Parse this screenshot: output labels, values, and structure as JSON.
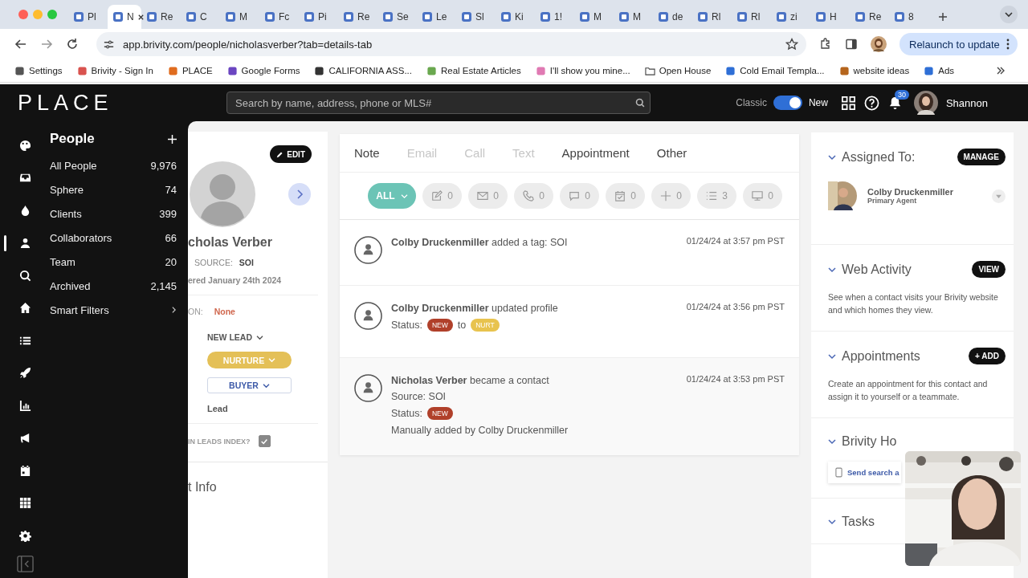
{
  "browser": {
    "tabs": [
      {
        "label": "Pl",
        "selected": false
      },
      {
        "label": "N",
        "selected": true
      },
      {
        "label": "Re",
        "selected": false
      },
      {
        "label": "C",
        "selected": false
      },
      {
        "label": "M",
        "selected": false
      },
      {
        "label": "Fc",
        "selected": false
      },
      {
        "label": "Pi",
        "selected": false
      },
      {
        "label": "Re",
        "selected": false
      },
      {
        "label": "Se",
        "selected": false
      },
      {
        "label": "Le",
        "selected": false
      },
      {
        "label": "Sl",
        "selected": false
      },
      {
        "label": "Ki",
        "selected": false
      },
      {
        "label": "1!",
        "selected": false
      },
      {
        "label": "M",
        "selected": false
      },
      {
        "label": "M",
        "selected": false
      },
      {
        "label": "de",
        "selected": false
      },
      {
        "label": "Rl",
        "selected": false
      },
      {
        "label": "Rl",
        "selected": false
      },
      {
        "label": "zi",
        "selected": false
      },
      {
        "label": "H",
        "selected": false
      },
      {
        "label": "Re",
        "selected": false
      },
      {
        "label": "8",
        "selected": false
      }
    ],
    "url": "app.brivity.com/people/nicholasverber?tab=details-tab",
    "relaunch": "Relaunch to update",
    "bookmarks": [
      "Settings",
      "Brivity - Sign In",
      "PLACE",
      "Google Forms",
      "CALIFORNIA ASS...",
      "Real Estate Articles",
      "I'll show you mine...",
      "Open House",
      "Cold Email Templa...",
      "website ideas",
      "Ads"
    ]
  },
  "header": {
    "logo": "PLACE",
    "search_placeholder": "Search by name, address, phone or MLS#",
    "toggle_left": "Classic",
    "toggle": {
      "on": true
    },
    "toggle_right": "New",
    "notification_count": "30",
    "user": "Shannon"
  },
  "rail": [
    {
      "selected": false
    },
    {
      "selected": false
    },
    {
      "selected": false
    },
    {
      "selected": true
    },
    {
      "selected": false
    },
    {
      "selected": false
    },
    {
      "selected": false
    },
    {
      "selected": false
    },
    {
      "selected": false
    },
    {
      "selected": false
    },
    {
      "selected": false
    },
    {
      "selected": false
    },
    {
      "selected": false
    }
  ],
  "sidebar": {
    "title": "People",
    "items": [
      {
        "label": "All People",
        "count": "9,976",
        "kind": "count"
      },
      {
        "label": "Sphere",
        "count": "74",
        "kind": "count"
      },
      {
        "label": "Clients",
        "count": "399",
        "kind": "count"
      },
      {
        "label": "Collaborators",
        "count": "66",
        "kind": "count"
      },
      {
        "label": "Team",
        "count": "20",
        "kind": "count"
      },
      {
        "label": "Archived",
        "count": "2,145",
        "kind": "count"
      },
      {
        "label": "Smart Filters",
        "kind": "submenu"
      }
    ]
  },
  "profile": {
    "edit": "EDIT",
    "name": "cholas Verber",
    "source_label": "SOURCE:",
    "source": "SOI",
    "entered": "ered January 24th 2024",
    "field_label": "ON:",
    "field_value": "None",
    "stage": "NEW LEAD",
    "status": "NURTURE",
    "type": "BUYER",
    "lead": "Lead",
    "index_label": "IN LEADS INDEX?",
    "in_index": true,
    "section": "t Info"
  },
  "timeline": {
    "tabs": [
      {
        "label": "Note",
        "disabled": false
      },
      {
        "label": "Email",
        "disabled": true
      },
      {
        "label": "Call",
        "disabled": true
      },
      {
        "label": "Text",
        "disabled": true
      },
      {
        "label": "Appointment",
        "disabled": false
      },
      {
        "label": "Other",
        "disabled": false
      }
    ],
    "filters": [
      {
        "label": "ALL",
        "selected": true
      },
      {
        "count": "0",
        "selected": false
      },
      {
        "count": "0",
        "selected": false
      },
      {
        "count": "0",
        "selected": false
      },
      {
        "count": "0",
        "selected": false
      },
      {
        "count": "0",
        "selected": false
      },
      {
        "count": "0",
        "selected": false
      },
      {
        "count": "3",
        "selected": false
      },
      {
        "count": "0",
        "selected": false
      }
    ],
    "events": [
      {
        "headline": "**Colby Druckenmiller** added a tag: SOI",
        "time": "01/24/24 at 3:57 pm PST"
      },
      {
        "headline": "**Colby Druckenmiller** updated profile",
        "time": "01/24/24 at 3:56 pm PST",
        "lines": [
          [
            {
              "kind": "text",
              "text": "Status:"
            },
            {
              "kind": "badge",
              "text": "NEW",
              "color": "#b0402a"
            },
            {
              "kind": "text",
              "text": "to"
            },
            {
              "kind": "badge",
              "text": "NURT",
              "color": "#e8c34e"
            }
          ]
        ]
      },
      {
        "headline": "**Nicholas Verber** became a contact",
        "time": "01/24/24 at 3:53 pm PST",
        "lines": [
          [
            {
              "kind": "text",
              "text": "Source: SOI"
            }
          ],
          [
            {
              "kind": "text",
              "text": "Status:"
            },
            {
              "kind": "badge",
              "text": "NEW",
              "color": "#b0402a"
            }
          ],
          [
            {
              "kind": "text",
              "text": "Manually added by Colby Druckenmiller"
            }
          ]
        ]
      }
    ]
  },
  "panel": {
    "sections": [
      {
        "title": "Assigned To:",
        "action": "MANAGE",
        "agent": {
          "name": "Colby Druckenmiller",
          "role": "Primary Agent"
        }
      },
      {
        "title": "Web Activity",
        "action": "VIEW",
        "text": "See when a contact visits your Brivity website and which homes they view."
      },
      {
        "title": "Appointments",
        "action": "+ ADD",
        "text": "Create an appointment for this contact and assign it to yourself or a teammate."
      },
      {
        "title": "Brivity Ho",
        "link": "Send search a"
      },
      {
        "title": "Tasks"
      }
    ]
  }
}
